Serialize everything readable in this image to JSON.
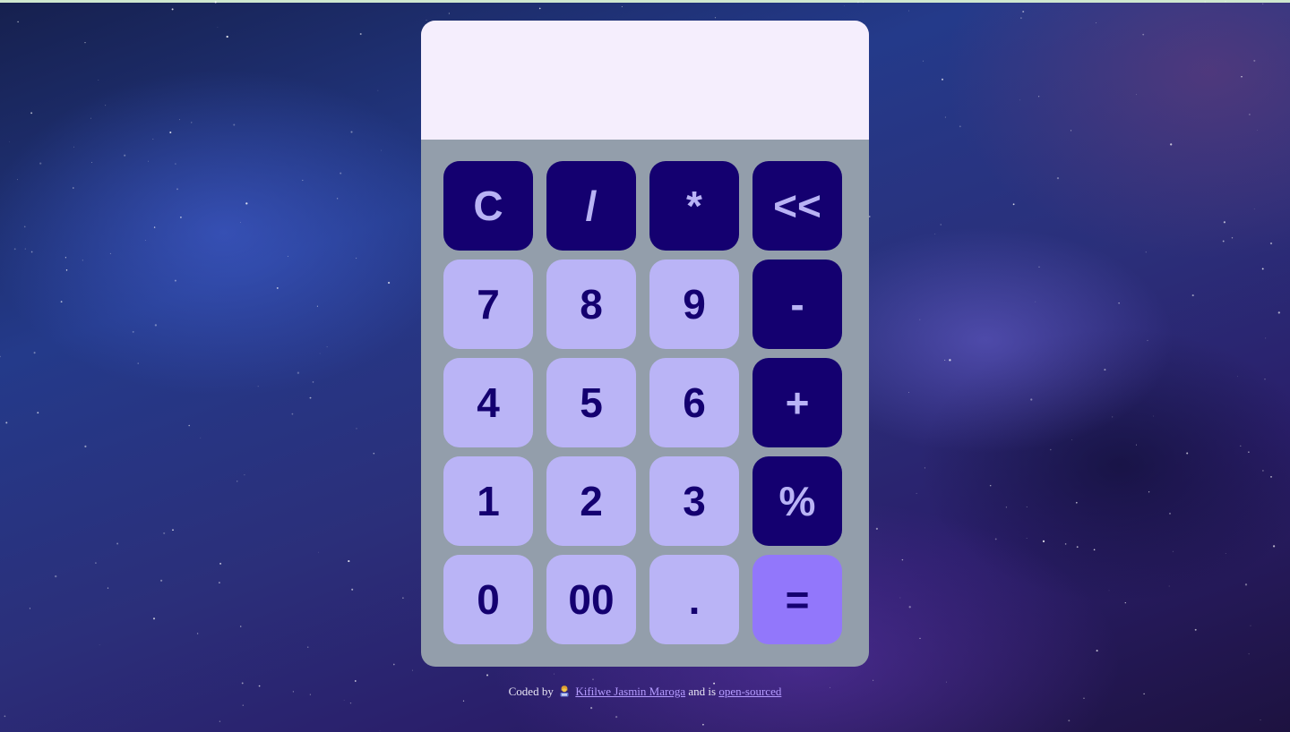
{
  "display": {
    "value": ""
  },
  "keys": [
    {
      "label": "C",
      "style": "dark"
    },
    {
      "label": "/",
      "style": "dark"
    },
    {
      "label": "*",
      "style": "dark"
    },
    {
      "label": "<<",
      "style": "dark"
    },
    {
      "label": "7",
      "style": "light"
    },
    {
      "label": "8",
      "style": "light"
    },
    {
      "label": "9",
      "style": "light"
    },
    {
      "label": "-",
      "style": "dark"
    },
    {
      "label": "4",
      "style": "light"
    },
    {
      "label": "5",
      "style": "light"
    },
    {
      "label": "6",
      "style": "light"
    },
    {
      "label": "+",
      "style": "dark"
    },
    {
      "label": "1",
      "style": "light"
    },
    {
      "label": "2",
      "style": "light"
    },
    {
      "label": "3",
      "style": "light"
    },
    {
      "label": "%",
      "style": "dark"
    },
    {
      "label": "0",
      "style": "light"
    },
    {
      "label": "00",
      "style": "light"
    },
    {
      "label": ".",
      "style": "light"
    },
    {
      "label": "=",
      "style": "equals"
    }
  ],
  "footer": {
    "prefix": "Coded by",
    "icon": "woman-technologist-icon",
    "author_link": "Kifilwe Jasmin Maroga",
    "middle": "and is",
    "source_link": "open-sourced"
  },
  "colors": {
    "dark_key": "#140070",
    "light_key": "#bab4f6",
    "equals_key": "#9277fb",
    "panel": "#939eab",
    "display_bg": "#f5eefd"
  }
}
